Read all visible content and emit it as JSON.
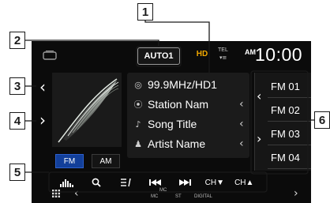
{
  "callouts": [
    "1",
    "2",
    "3",
    "4",
    "5",
    "6"
  ],
  "status": {
    "auto_label": "AUTO1",
    "hd_label": "HD",
    "tel_label": "TEL",
    "signal": "▾≡",
    "ampm": "AM",
    "clock": "10:00"
  },
  "station": {
    "frequency": "99.9MHz/HD1",
    "station_name": "Station Nam",
    "song_title": "Song Title",
    "artist_name": "Artist Name"
  },
  "bands": {
    "fm": "FM",
    "am": "AM"
  },
  "presets": [
    "FM 01",
    "FM 02",
    "FM 03",
    "FM 04"
  ],
  "controls": {
    "channel_down": "CH▼",
    "channel_up": "CH▲"
  },
  "bottom": {
    "indicator_mc_top": "MC",
    "indicator_mc": "MC",
    "indicator_st": "ST",
    "indicator_digital": "DIGITAL"
  },
  "colors": {
    "accent_blue": "#123f9a",
    "hd_orange": "#f2a900",
    "screen_bg": "#0b0b0b"
  }
}
